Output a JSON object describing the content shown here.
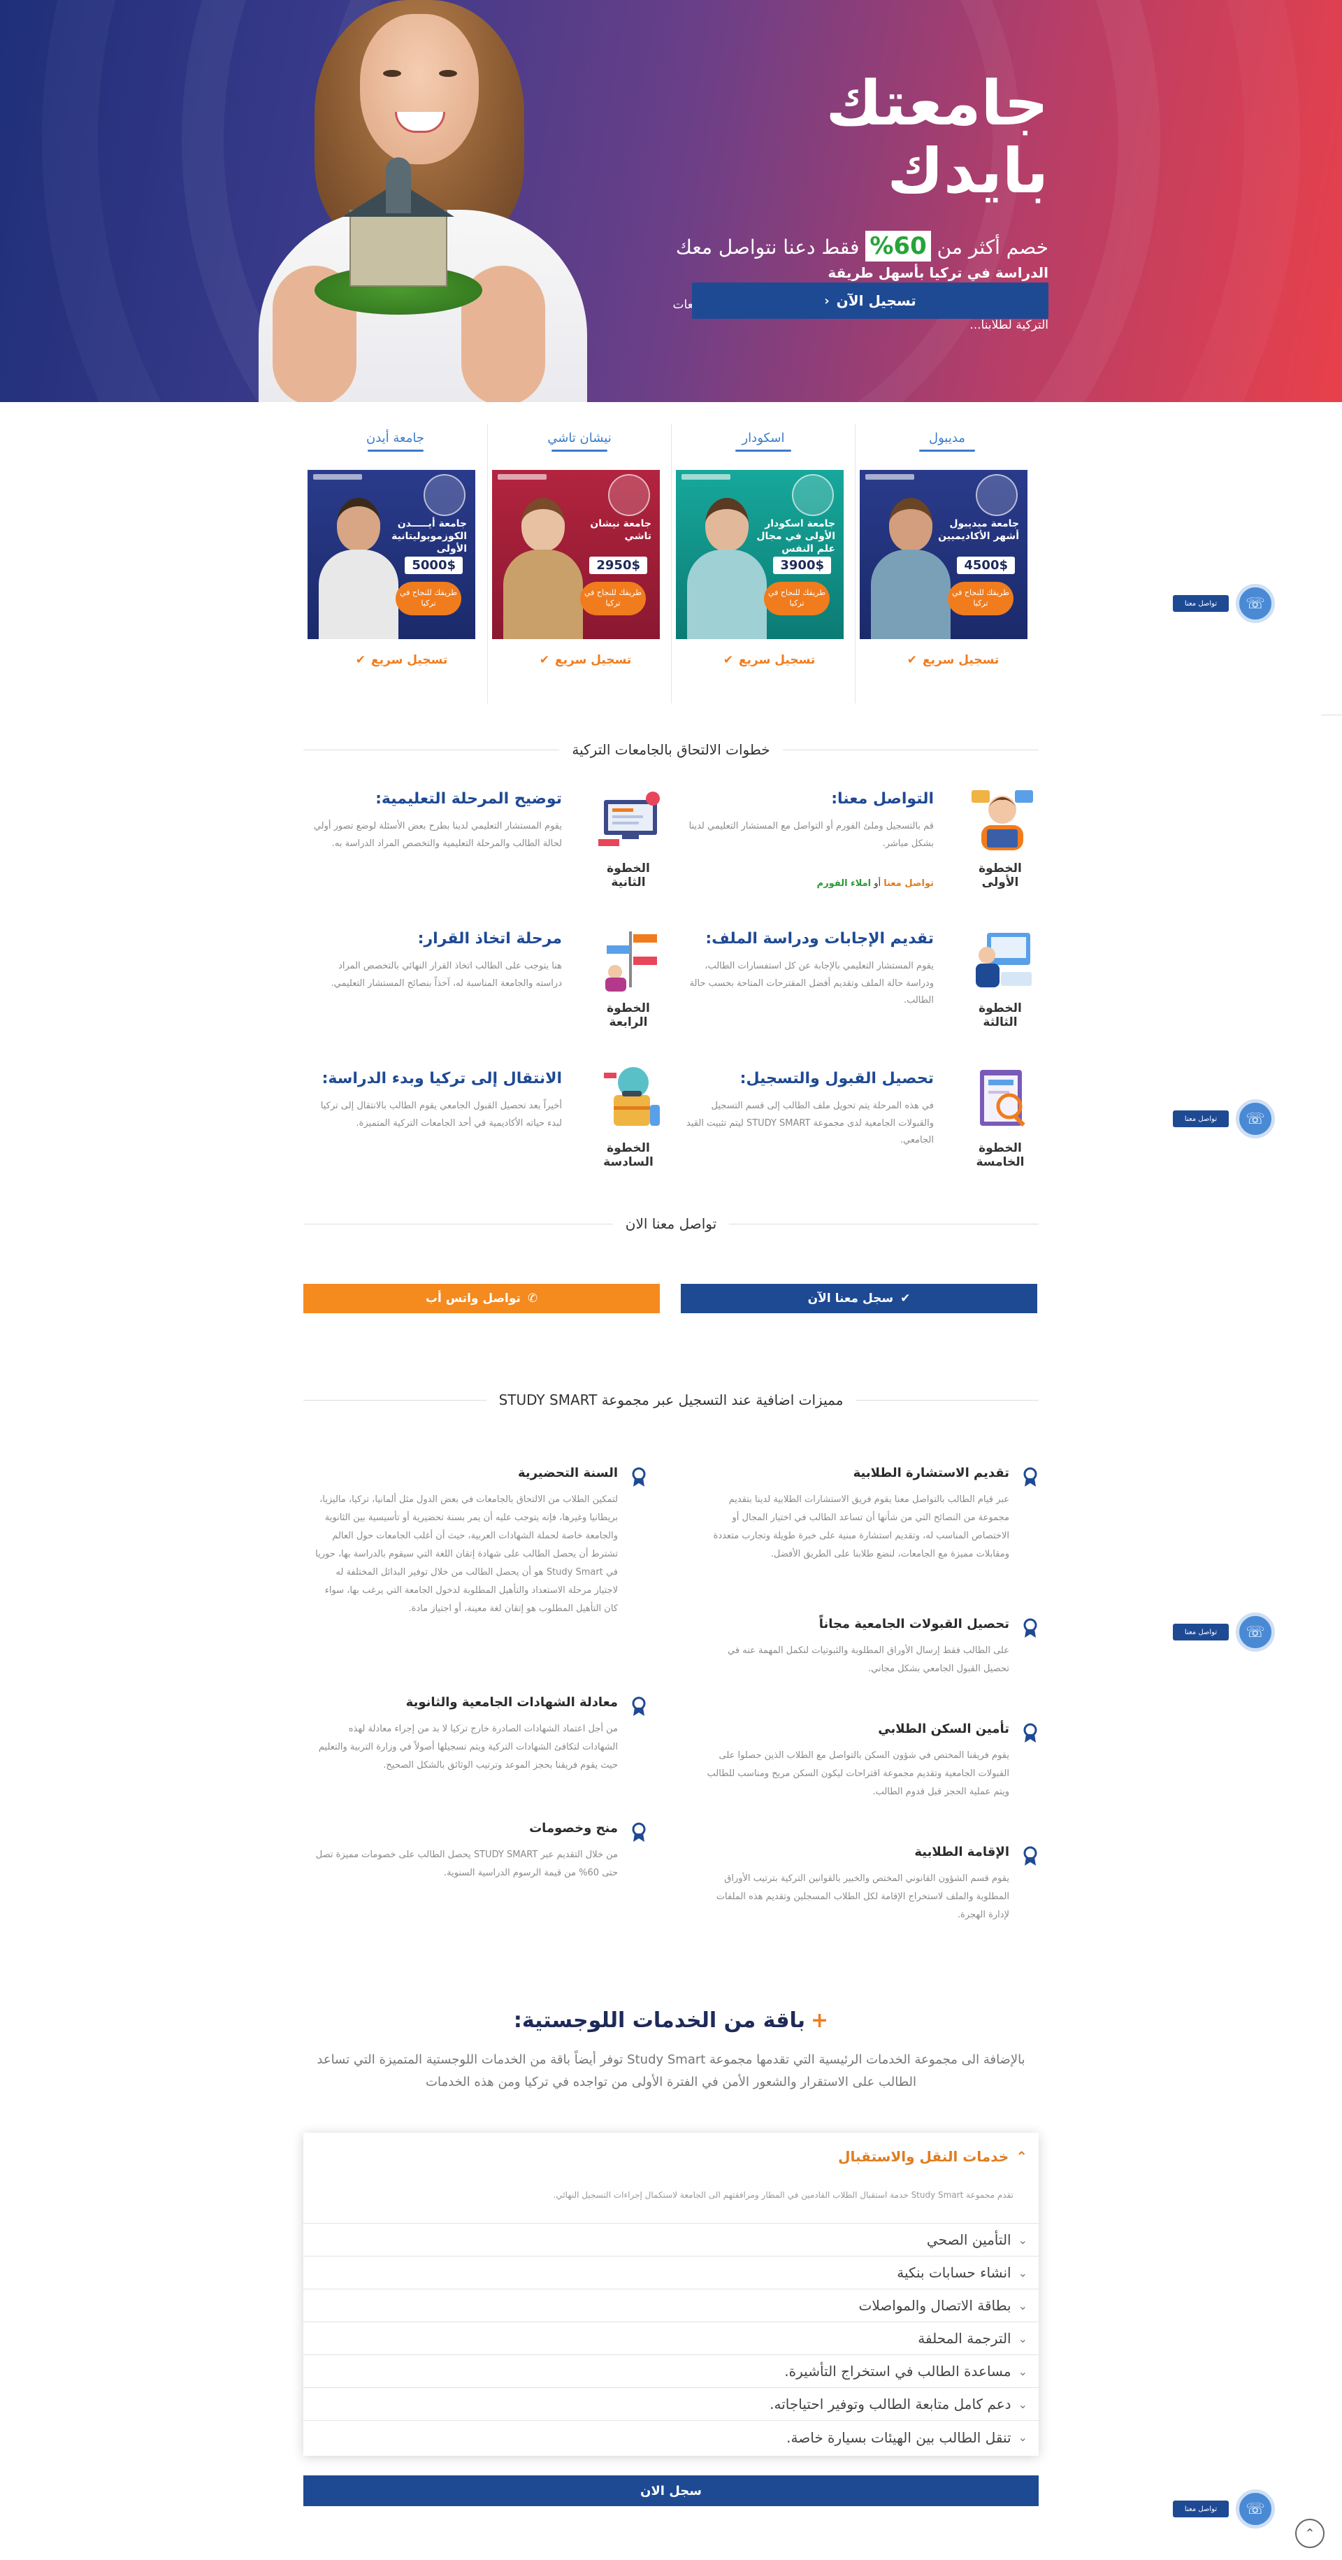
{
  "hero": {
    "title": "جامعتك بايدك",
    "discount_before": "خصم أكثر من ",
    "discount_pct": "%60",
    "discount_after": " فقط دعنا نتواصل معك",
    "subtitle": "الدراسة في تركيا بأسهل طريقة",
    "desc": "سجل معنا للاستفادة من العروض والخصومات الحصرية التي تقدمها الجامعات التركية لطلابنا...",
    "cta": "تسجيل الآن"
  },
  "universities": [
    {
      "name": "مديبول",
      "card_title": "جامعة ميديبول أشهر الأكاديميين",
      "price": "4500$",
      "promo": "طريقك للنجاح في تركيا",
      "quick": "تسجيل سريع",
      "bg": "#22337a"
    },
    {
      "name": "اسكودار",
      "card_title": "جامعة اسكودار الأولى في مجال علم النفس",
      "price": "3900$",
      "promo": "طريقك للنجاح في تركيا",
      "quick": "تسجيل سريع",
      "bg": "#10938a"
    },
    {
      "name": "نيشان تاشي",
      "card_title": "جامعة نيشان تاشي",
      "price": "2950$",
      "promo": "طريقك للنجاح في تركيا",
      "quick": "تسجيل سريع",
      "bg": "#a31e3a"
    },
    {
      "name": "جامعة أيدن",
      "card_title": "جامعة أيـــــدن الكوزموبوليتانية الأولى",
      "price": "5000$",
      "promo": "طريقك للنجاح في تركيا",
      "quick": "تسجيل سريع",
      "bg": "#22337a"
    }
  ],
  "steps_section_title": "خطوات الالتحاق بالجامعات التركية",
  "steps": [
    {
      "label": "الخطوة الأولى",
      "title": "التواصل معنا:",
      "text": "قم بالتسجيل وملئ الفورم أو التواصل مع المستشار التعليمي لدينا بشكل مباشر.",
      "link_a": "تواصل معنا",
      "link_sep": " أو ",
      "link_b": "املاء الفورم"
    },
    {
      "label": "الخطوة الثانية",
      "title": "توضيح المرحلة التعليمية:",
      "text": "يقوم المستشار التعليمي لدينا بطرح بعض الأسئلة لوضع تصور أولي لحالة الطالب والمرحلة التعليمية والتخصص المراد الدراسة به."
    },
    {
      "label": "الخطوة الثالثة",
      "title": "تقديم الإجابات ودراسة الملف:",
      "text": "يقوم المستشار التعليمي بالإجابة عن كل استفسارات الطالب، ودراسة حالة الملف وتقديم أفضل المقترحات المتاحة بحسب حالة الطالب."
    },
    {
      "label": "الخطوة الرابعة",
      "title": "مرحلة اتخاذ القرار:",
      "text": "هنا يتوجب على الطالب اتخاذ القرار النهائي بالتخصص المراد دراسته والجامعة المناسبة له، آخذاً بنصائح المستشار التعليمي."
    },
    {
      "label": "الخطوة الخامسة",
      "title": "تحصيل القبول والتسجيل:",
      "text": "في هذه المرحلة يتم تحويل ملف الطالب إلى قسم التسجيل والقبولات الجامعية لدى مجموعة STUDY SMART ليتم تثبيت القيد الجامعي."
    },
    {
      "label": "الخطوة السادسة",
      "title": "الانتقال إلى تركيا وبدء الدراسة:",
      "text": "أخيراً بعد تحصيل القبول الجامعي يقوم الطالب بالانتقال إلى تركيا لبدء حياته الأكاديمية في أحد الجامعات التركية المتميزة."
    }
  ],
  "contact_section_title": "تواصل معنا الان",
  "buttons": {
    "register": "سجل معنا الآن",
    "whatsapp": "تواصل واتس أب"
  },
  "features_section_title": "مميزات اضافية عند التسجيل عبر مجموعة STUDY SMART",
  "features": [
    {
      "title": "تقديم الاستشارة الطلابية",
      "text": "عبر قيام الطالب بالتواصل معنا يقوم فريق الاستشارات الطلابية لدينا بتقديم مجموعة من النصائح التي من شأنها أن تساعد الطالب في اختيار المجال أو الاختصاص المناسب له، وتقديم استشارة مبنية على خبرة طويلة وتجارب متعددة ومقابلات مميزة مع الجامعات، لنضع طلابنا على الطريق الأفضل."
    },
    {
      "title": "تحصيل القبولات الجامعية مجاناً",
      "text": "على الطالب فقط إرسال الأوراق المطلوبة والثبوتيات لنكمل المهمة عنه في تحصيل القبول الجامعي بشكل مجاني."
    },
    {
      "title": "تأمين السكن الطلابي",
      "text": "يقوم فريقنا المختص في شؤون السكن بالتواصل مع الطلاب الذين حصلوا على القبولات الجامعية وتقديم مجموعة اقتراحات ليكون السكن مريح ومناسب للطالب ويتم عملية الحجز قبل قدوم الطالب."
    },
    {
      "title": "الإقامة الطلابية",
      "text": "يقوم قسم الشؤون القانوني المختص والخبير بالقوانين التركية بترتيب الأوراق المطلوبة والملف لاستخراج الإقامة لكل الطلاب المسجلين وتقديم هذه الملفات لإدارة الهجرة."
    },
    {
      "title": "السنة التحضيرية",
      "text": "لتمكين الطلاب من الالتحاق بالجامعات في بعض الدول مثل ألمانيا، تركيا، ماليزيا، بريطانيا وغيرها، فإنه يتوجب عليه أن يمر بسنة تحضيرية أو تأسيسية بين الثانوية والجامعة خاصة لحملة الشهادات العربية، حيث أن أغلب الجامعات حول العالم تشترط أن يحصل الطالب على شهادة إتقان اللغة التي سيقوم بالدراسة بها، حوريا في Study Smart هو أن يحصل الطالب من خلال توفير البدائل المختلفة له لاجتياز مرحلة الاستعداد والتأهيل المطلوبة لدخول الجامعة التي يرغب بها، سواء كان التأهيل المطلوب هو إتقان لغة معينة، أو اجتياز مادة."
    },
    {
      "title": "معادلة الشهادات الجامعية والثانوية",
      "text": "من أجل اعتماد الشهادات الصادرة خارج تركيا لا بد من إجراء معادلة لهذه الشهادات لتكافئ الشهادات التركية ويتم تسجيلها أصولاً في وزارة التربية والتعليم حيث يقوم فريقنا بحجز الموعد وترتيب الوثائق بالشكل الصحيح."
    },
    {
      "title": "منح وخصومات",
      "text": "من خلال التقديم عبر STUDY SMART يحصل الطالب على خصومات مميزة تصل حتى 60% من قيمة الرسوم الدراسية السنوية."
    }
  ],
  "logistics": {
    "title": "باقة من الخدمات اللوجستية:",
    "plus": "+",
    "desc": "بالإضافة الى مجموعة الخدمات الرئيسية التي تقدمها مجموعة Study Smart توفر أيضاً باقة من الخدمات اللوجستية المتميزة التي تساعد الطالب على الاستقرار والشعور الأمن في الفترة الأولى من تواجده في تركيا ومن هذه الخدمات",
    "open_title": "خدمات النقل والاستقبال",
    "open_text": "تقدم مجموعة Study Smart خدمة استقبال الطلاب القادمين في المطار ومرافقتهم الى الجامعة لاستكمال إجراءات التسجيل النهائي.",
    "items": [
      "التأمين الصحي",
      "انشاء حسابات بنكية",
      "بطاقة الاتصال والمواصلات",
      "الترجمة المحلفة",
      "مساعدة الطالب في استخراج التأشيرة.",
      "دعم كامل متابعة الطالب وتوفير احتياجاته.",
      "تنقل الطالب بين الهيئات بسيارة خاصة."
    ],
    "signup": "سجل الان"
  },
  "floating": {
    "label": "تواصل معنا"
  },
  "icons": {
    "check": "check-icon",
    "headset": "headset-icon",
    "award": "award-icon",
    "chevron": "chevron-down-icon",
    "arrow_up": "arrow-up-icon",
    "whatsapp": "phone-icon"
  },
  "colors": {
    "primary": "#1e4a94",
    "accent": "#f07c1e",
    "link": "#3a7bc8"
  }
}
